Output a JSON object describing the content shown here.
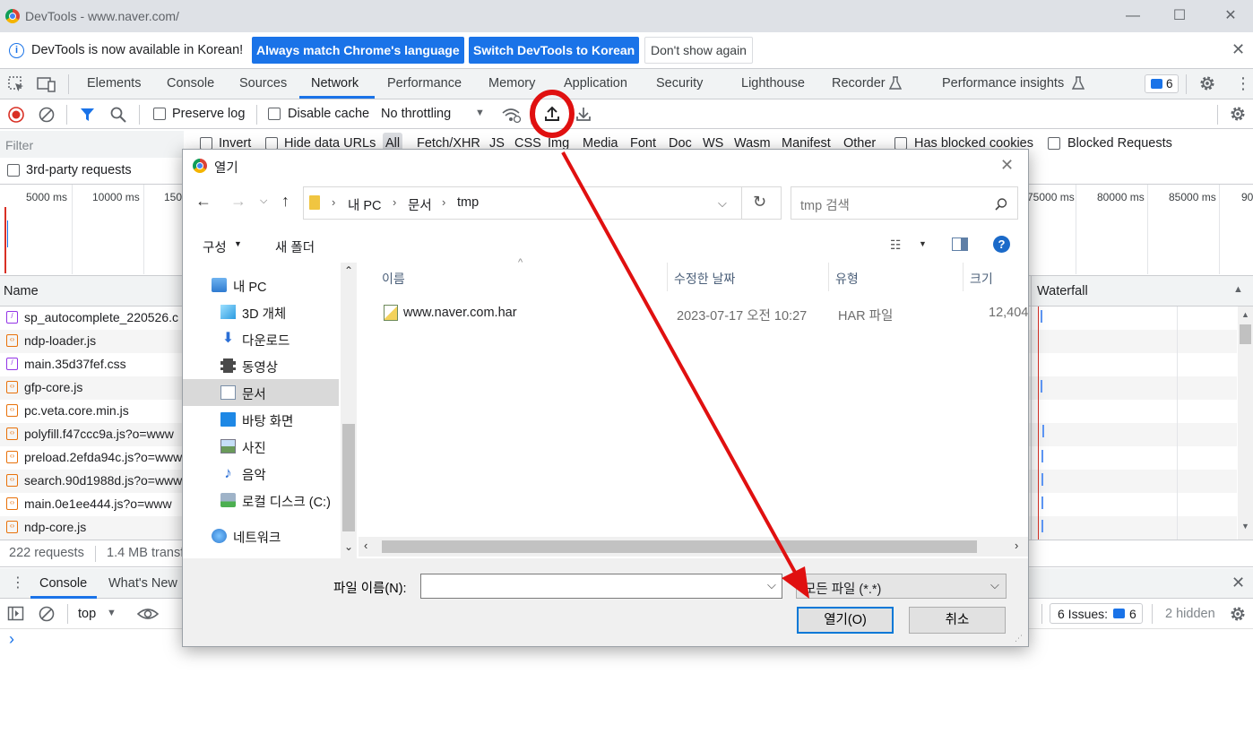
{
  "window": {
    "title": "DevTools - www.naver.com/",
    "minimize": "—",
    "maximize": "☐",
    "close": "✕"
  },
  "infobar": {
    "message": "DevTools is now available in Korean!",
    "btn_match": "Always match Chrome's language",
    "btn_switch": "Switch DevTools to Korean",
    "btn_dont_show": "Don't show again",
    "close": "✕"
  },
  "tabs": [
    "Elements",
    "Console",
    "Sources",
    "Network",
    "Performance",
    "Memory",
    "Application",
    "Security",
    "Lighthouse",
    "Recorder",
    "Performance insights"
  ],
  "active_tab": "Network",
  "issues_badge": "6",
  "network_toolbar": {
    "preserve_log": "Preserve log",
    "disable_cache": "Disable cache",
    "throttling": "No throttling"
  },
  "filter": {
    "placeholder": "Filter",
    "invert": "Invert",
    "hide_data_urls": "Hide data URLs",
    "types": [
      "All",
      "Fetch/XHR",
      "JS",
      "CSS",
      "Img",
      "Media",
      "Font",
      "Doc",
      "WS",
      "Wasm",
      "Manifest",
      "Other"
    ],
    "has_blocked_cookies": "Has blocked cookies",
    "blocked_requests": "Blocked Requests",
    "third_party": "3rd-party requests"
  },
  "timeline": {
    "left_ticks": [
      "5000 ms",
      "10000 ms",
      "150"
    ],
    "right_ticks": [
      "75000 ms",
      "80000 ms",
      "85000 ms",
      "90"
    ]
  },
  "requests": {
    "col_name": "Name",
    "col_waterfall": "Waterfall",
    "rows": [
      {
        "name": "sp_autocomplete_220526.c",
        "kind": "css"
      },
      {
        "name": "ndp-loader.js",
        "kind": "js"
      },
      {
        "name": "main.35d37fef.css",
        "kind": "css"
      },
      {
        "name": "gfp-core.js",
        "kind": "js"
      },
      {
        "name": "pc.veta.core.min.js",
        "kind": "js"
      },
      {
        "name": "polyfill.f47ccc9a.js?o=www",
        "kind": "js"
      },
      {
        "name": "preload.2efda94c.js?o=www",
        "kind": "js"
      },
      {
        "name": "search.90d1988d.js?o=www",
        "kind": "js"
      },
      {
        "name": "main.0e1ee444.js?o=www",
        "kind": "js"
      },
      {
        "name": "ndp-core.js",
        "kind": "js"
      }
    ]
  },
  "status": {
    "requests": "222 requests",
    "transferred": "1.4 MB transf"
  },
  "drawer": {
    "tab_console": "Console",
    "tab_whats_new": "What's New",
    "context": "top",
    "issues": "6 Issues:",
    "issues_count": "6",
    "hidden": "2 hidden",
    "prompt": "›"
  },
  "dialog": {
    "title": "열기",
    "breadcrumb": [
      "내 PC",
      "문서",
      "tmp"
    ],
    "search_placeholder": "tmp 검색",
    "organize": "구성",
    "new_folder": "새 폴더",
    "nav": [
      {
        "label": "내 PC",
        "icon": "pc-icon"
      },
      {
        "label": "3D 개체",
        "icon": "cube-icon"
      },
      {
        "label": "다운로드",
        "icon": "download-icon"
      },
      {
        "label": "동영상",
        "icon": "video-icon"
      },
      {
        "label": "문서",
        "icon": "document-icon"
      },
      {
        "label": "바탕 화면",
        "icon": "desktop-icon"
      },
      {
        "label": "사진",
        "icon": "picture-icon"
      },
      {
        "label": "음악",
        "icon": "music-icon"
      },
      {
        "label": "로컬 디스크 (C:)",
        "icon": "disk-icon"
      },
      {
        "label": "네트워크",
        "icon": "network-icon"
      }
    ],
    "selected_nav": "문서",
    "columns": [
      "이름",
      "수정한 날짜",
      "유형",
      "크기"
    ],
    "files": [
      {
        "name": "www.naver.com.har",
        "date": "2023-07-17 오전 10:27",
        "type": "HAR 파일",
        "size": "12,404"
      }
    ],
    "filename_label": "파일 이름(N):",
    "filename_value": "",
    "filetype": "모든 파일 (*.*)",
    "btn_open": "열기(O)",
    "btn_cancel": "취소"
  },
  "colors": {
    "accent": "#1a73e8",
    "annotation": "#e01010",
    "record": "#d93025"
  }
}
